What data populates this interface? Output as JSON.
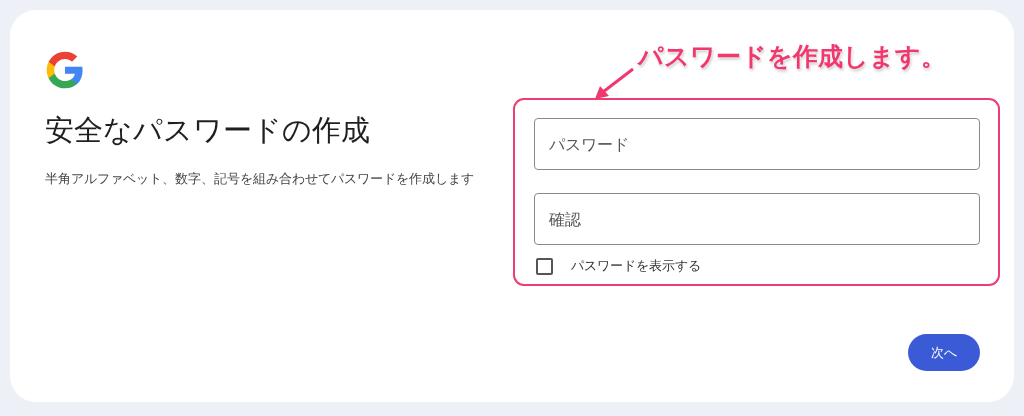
{
  "heading": "安全なパスワードの作成",
  "description": "半角アルファベット、数字、記号を組み合わせてパスワードを作成します",
  "annotation": {
    "text": "パスワードを作成します。"
  },
  "fields": [
    {
      "placeholder": "パスワード"
    },
    {
      "placeholder": "確認"
    }
  ],
  "show_password": {
    "label": "パスワードを表示する",
    "checked": false
  },
  "buttons": [
    {
      "label": "次へ"
    }
  ]
}
